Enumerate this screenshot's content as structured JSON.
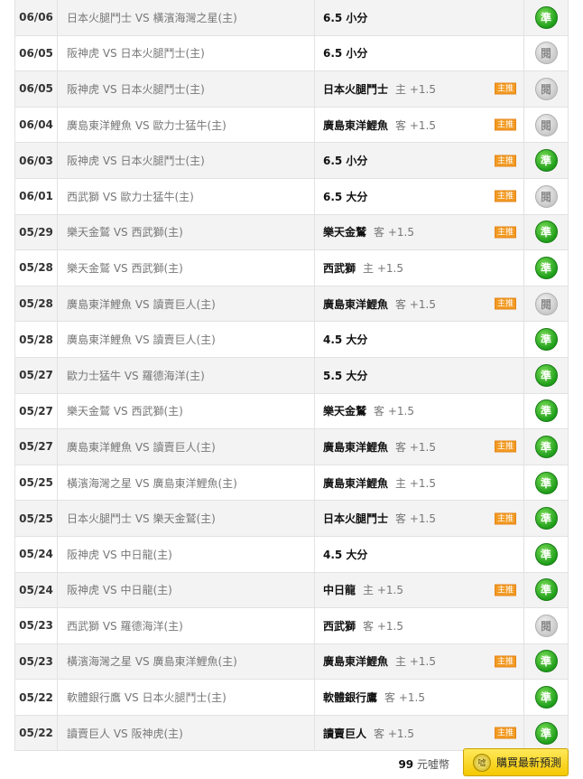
{
  "rows": [
    {
      "date": "06/06",
      "match": "日本火腿鬥士 VS 橫濱海灣之星(主)",
      "pick": "6.5 小分",
      "sub": "",
      "badge": "",
      "result": "準",
      "result_type": "win"
    },
    {
      "date": "06/05",
      "match": "阪神虎 VS 日本火腿鬥士(主)",
      "pick": "6.5 小分",
      "sub": "",
      "badge": "",
      "result": "閱",
      "result_type": "read"
    },
    {
      "date": "06/05",
      "match": "阪神虎 VS 日本火腿鬥士(主)",
      "pick": "日本火腿鬥士",
      "sub": "主 +1.5",
      "badge": "主推",
      "result": "閱",
      "result_type": "read"
    },
    {
      "date": "06/04",
      "match": "廣島東洋鯉魚 VS 歐力士猛牛(主)",
      "pick": "廣島東洋鯉魚",
      "sub": "客 +1.5",
      "badge": "主推",
      "result": "閱",
      "result_type": "read"
    },
    {
      "date": "06/03",
      "match": "阪神虎 VS 日本火腿鬥士(主)",
      "pick": "6.5 小分",
      "sub": "",
      "badge": "主推",
      "result": "準",
      "result_type": "win"
    },
    {
      "date": "06/01",
      "match": "西武獅 VS 歐力士猛牛(主)",
      "pick": "6.5 大分",
      "sub": "",
      "badge": "主推",
      "result": "閱",
      "result_type": "read"
    },
    {
      "date": "05/29",
      "match": "樂天金鷲 VS 西武獅(主)",
      "pick": "樂天金鷲",
      "sub": "客 +1.5",
      "badge": "主推",
      "result": "準",
      "result_type": "win"
    },
    {
      "date": "05/28",
      "match": "樂天金鷲 VS 西武獅(主)",
      "pick": "西武獅",
      "sub": "主 +1.5",
      "badge": "",
      "result": "準",
      "result_type": "win"
    },
    {
      "date": "05/28",
      "match": "廣島東洋鯉魚 VS 讀賣巨人(主)",
      "pick": "廣島東洋鯉魚",
      "sub": "客 +1.5",
      "badge": "主推",
      "result": "閱",
      "result_type": "read"
    },
    {
      "date": "05/28",
      "match": "廣島東洋鯉魚 VS 讀賣巨人(主)",
      "pick": "4.5 大分",
      "sub": "",
      "badge": "",
      "result": "準",
      "result_type": "win"
    },
    {
      "date": "05/27",
      "match": "歐力士猛牛 VS 羅德海洋(主)",
      "pick": "5.5 大分",
      "sub": "",
      "badge": "",
      "result": "準",
      "result_type": "win"
    },
    {
      "date": "05/27",
      "match": "樂天金鷲 VS 西武獅(主)",
      "pick": "樂天金鷲",
      "sub": "客 +1.5",
      "badge": "",
      "result": "準",
      "result_type": "win"
    },
    {
      "date": "05/27",
      "match": "廣島東洋鯉魚 VS 讀賣巨人(主)",
      "pick": "廣島東洋鯉魚",
      "sub": "客 +1.5",
      "badge": "主推",
      "result": "準",
      "result_type": "win"
    },
    {
      "date": "05/25",
      "match": "橫濱海灣之星 VS 廣島東洋鯉魚(主)",
      "pick": "廣島東洋鯉魚",
      "sub": "主 +1.5",
      "badge": "",
      "result": "準",
      "result_type": "win"
    },
    {
      "date": "05/25",
      "match": "日本火腿鬥士 VS 樂天金鷲(主)",
      "pick": "日本火腿鬥士",
      "sub": "客 +1.5",
      "badge": "主推",
      "result": "準",
      "result_type": "win"
    },
    {
      "date": "05/24",
      "match": "阪神虎 VS 中日龍(主)",
      "pick": "4.5 大分",
      "sub": "",
      "badge": "",
      "result": "準",
      "result_type": "win"
    },
    {
      "date": "05/24",
      "match": "阪神虎 VS 中日龍(主)",
      "pick": "中日龍",
      "sub": "主 +1.5",
      "badge": "主推",
      "result": "準",
      "result_type": "win"
    },
    {
      "date": "05/23",
      "match": "西武獅 VS 羅德海洋(主)",
      "pick": "西武獅",
      "sub": "客 +1.5",
      "badge": "",
      "result": "閱",
      "result_type": "read"
    },
    {
      "date": "05/23",
      "match": "橫濱海灣之星 VS 廣島東洋鯉魚(主)",
      "pick": "廣島東洋鯉魚",
      "sub": "主 +1.5",
      "badge": "主推",
      "result": "準",
      "result_type": "win"
    },
    {
      "date": "05/22",
      "match": "軟體銀行鷹 VS 日本火腿鬥士(主)",
      "pick": "軟體銀行鷹",
      "sub": "客 +1.5",
      "badge": "",
      "result": "準",
      "result_type": "win"
    },
    {
      "date": "05/22",
      "match": "讀賣巨人 VS 阪神虎(主)",
      "pick": "讀賣巨人",
      "sub": "客 +1.5",
      "badge": "主推",
      "result": "準",
      "result_type": "win"
    }
  ],
  "footer": {
    "price_value": "99",
    "price_unit": "元噓幣",
    "coin_glyph": "噓",
    "buy_label": "購買最新預測"
  },
  "colors": {
    "win": "#1e9d1a",
    "read": "#c9c9c9",
    "badge": "#f29a22",
    "button": "#f5c800"
  }
}
